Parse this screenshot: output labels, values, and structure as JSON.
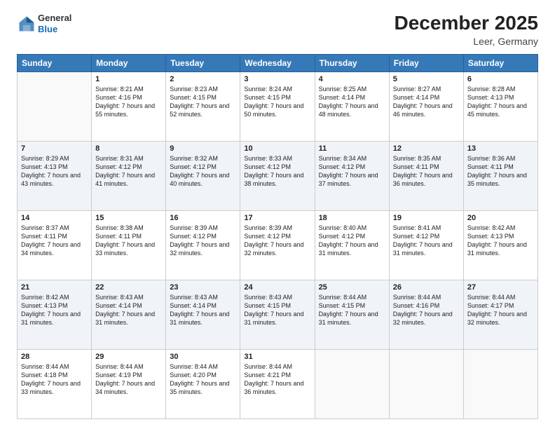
{
  "header": {
    "logo": {
      "general": "General",
      "blue": "Blue"
    },
    "title": "December 2025",
    "location": "Leer, Germany"
  },
  "weekdays": [
    "Sunday",
    "Monday",
    "Tuesday",
    "Wednesday",
    "Thursday",
    "Friday",
    "Saturday"
  ],
  "weeks": [
    [
      {
        "day": "",
        "sunrise": "",
        "sunset": "",
        "daylight": ""
      },
      {
        "day": "1",
        "sunrise": "Sunrise: 8:21 AM",
        "sunset": "Sunset: 4:16 PM",
        "daylight": "Daylight: 7 hours and 55 minutes."
      },
      {
        "day": "2",
        "sunrise": "Sunrise: 8:23 AM",
        "sunset": "Sunset: 4:15 PM",
        "daylight": "Daylight: 7 hours and 52 minutes."
      },
      {
        "day": "3",
        "sunrise": "Sunrise: 8:24 AM",
        "sunset": "Sunset: 4:15 PM",
        "daylight": "Daylight: 7 hours and 50 minutes."
      },
      {
        "day": "4",
        "sunrise": "Sunrise: 8:25 AM",
        "sunset": "Sunset: 4:14 PM",
        "daylight": "Daylight: 7 hours and 48 minutes."
      },
      {
        "day": "5",
        "sunrise": "Sunrise: 8:27 AM",
        "sunset": "Sunset: 4:14 PM",
        "daylight": "Daylight: 7 hours and 46 minutes."
      },
      {
        "day": "6",
        "sunrise": "Sunrise: 8:28 AM",
        "sunset": "Sunset: 4:13 PM",
        "daylight": "Daylight: 7 hours and 45 minutes."
      }
    ],
    [
      {
        "day": "7",
        "sunrise": "Sunrise: 8:29 AM",
        "sunset": "Sunset: 4:13 PM",
        "daylight": "Daylight: 7 hours and 43 minutes."
      },
      {
        "day": "8",
        "sunrise": "Sunrise: 8:31 AM",
        "sunset": "Sunset: 4:12 PM",
        "daylight": "Daylight: 7 hours and 41 minutes."
      },
      {
        "day": "9",
        "sunrise": "Sunrise: 8:32 AM",
        "sunset": "Sunset: 4:12 PM",
        "daylight": "Daylight: 7 hours and 40 minutes."
      },
      {
        "day": "10",
        "sunrise": "Sunrise: 8:33 AM",
        "sunset": "Sunset: 4:12 PM",
        "daylight": "Daylight: 7 hours and 38 minutes."
      },
      {
        "day": "11",
        "sunrise": "Sunrise: 8:34 AM",
        "sunset": "Sunset: 4:12 PM",
        "daylight": "Daylight: 7 hours and 37 minutes."
      },
      {
        "day": "12",
        "sunrise": "Sunrise: 8:35 AM",
        "sunset": "Sunset: 4:11 PM",
        "daylight": "Daylight: 7 hours and 36 minutes."
      },
      {
        "day": "13",
        "sunrise": "Sunrise: 8:36 AM",
        "sunset": "Sunset: 4:11 PM",
        "daylight": "Daylight: 7 hours and 35 minutes."
      }
    ],
    [
      {
        "day": "14",
        "sunrise": "Sunrise: 8:37 AM",
        "sunset": "Sunset: 4:11 PM",
        "daylight": "Daylight: 7 hours and 34 minutes."
      },
      {
        "day": "15",
        "sunrise": "Sunrise: 8:38 AM",
        "sunset": "Sunset: 4:11 PM",
        "daylight": "Daylight: 7 hours and 33 minutes."
      },
      {
        "day": "16",
        "sunrise": "Sunrise: 8:39 AM",
        "sunset": "Sunset: 4:12 PM",
        "daylight": "Daylight: 7 hours and 32 minutes."
      },
      {
        "day": "17",
        "sunrise": "Sunrise: 8:39 AM",
        "sunset": "Sunset: 4:12 PM",
        "daylight": "Daylight: 7 hours and 32 minutes."
      },
      {
        "day": "18",
        "sunrise": "Sunrise: 8:40 AM",
        "sunset": "Sunset: 4:12 PM",
        "daylight": "Daylight: 7 hours and 31 minutes."
      },
      {
        "day": "19",
        "sunrise": "Sunrise: 8:41 AM",
        "sunset": "Sunset: 4:12 PM",
        "daylight": "Daylight: 7 hours and 31 minutes."
      },
      {
        "day": "20",
        "sunrise": "Sunrise: 8:42 AM",
        "sunset": "Sunset: 4:13 PM",
        "daylight": "Daylight: 7 hours and 31 minutes."
      }
    ],
    [
      {
        "day": "21",
        "sunrise": "Sunrise: 8:42 AM",
        "sunset": "Sunset: 4:13 PM",
        "daylight": "Daylight: 7 hours and 31 minutes."
      },
      {
        "day": "22",
        "sunrise": "Sunrise: 8:43 AM",
        "sunset": "Sunset: 4:14 PM",
        "daylight": "Daylight: 7 hours and 31 minutes."
      },
      {
        "day": "23",
        "sunrise": "Sunrise: 8:43 AM",
        "sunset": "Sunset: 4:14 PM",
        "daylight": "Daylight: 7 hours and 31 minutes."
      },
      {
        "day": "24",
        "sunrise": "Sunrise: 8:43 AM",
        "sunset": "Sunset: 4:15 PM",
        "daylight": "Daylight: 7 hours and 31 minutes."
      },
      {
        "day": "25",
        "sunrise": "Sunrise: 8:44 AM",
        "sunset": "Sunset: 4:15 PM",
        "daylight": "Daylight: 7 hours and 31 minutes."
      },
      {
        "day": "26",
        "sunrise": "Sunrise: 8:44 AM",
        "sunset": "Sunset: 4:16 PM",
        "daylight": "Daylight: 7 hours and 32 minutes."
      },
      {
        "day": "27",
        "sunrise": "Sunrise: 8:44 AM",
        "sunset": "Sunset: 4:17 PM",
        "daylight": "Daylight: 7 hours and 32 minutes."
      }
    ],
    [
      {
        "day": "28",
        "sunrise": "Sunrise: 8:44 AM",
        "sunset": "Sunset: 4:18 PM",
        "daylight": "Daylight: 7 hours and 33 minutes."
      },
      {
        "day": "29",
        "sunrise": "Sunrise: 8:44 AM",
        "sunset": "Sunset: 4:19 PM",
        "daylight": "Daylight: 7 hours and 34 minutes."
      },
      {
        "day": "30",
        "sunrise": "Sunrise: 8:44 AM",
        "sunset": "Sunset: 4:20 PM",
        "daylight": "Daylight: 7 hours and 35 minutes."
      },
      {
        "day": "31",
        "sunrise": "Sunrise: 8:44 AM",
        "sunset": "Sunset: 4:21 PM",
        "daylight": "Daylight: 7 hours and 36 minutes."
      },
      {
        "day": "",
        "sunrise": "",
        "sunset": "",
        "daylight": ""
      },
      {
        "day": "",
        "sunrise": "",
        "sunset": "",
        "daylight": ""
      },
      {
        "day": "",
        "sunrise": "",
        "sunset": "",
        "daylight": ""
      }
    ]
  ]
}
